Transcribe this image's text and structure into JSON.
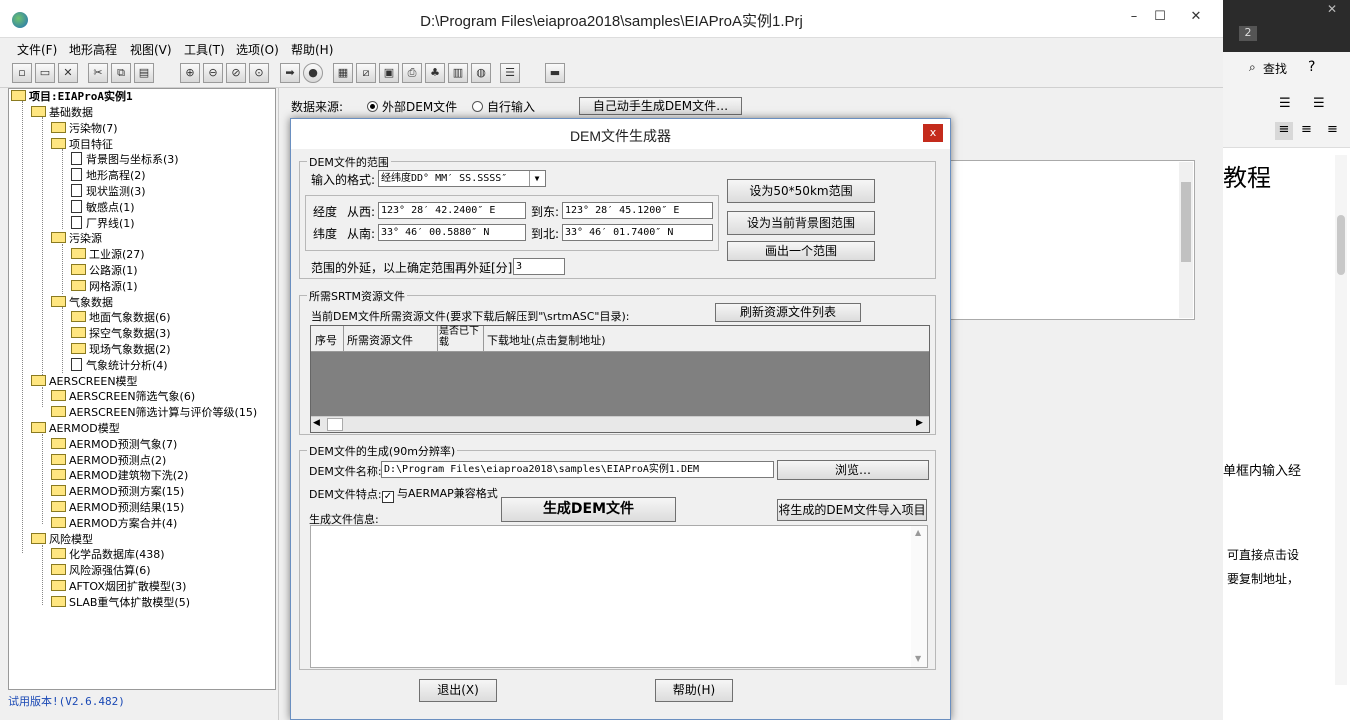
{
  "window": {
    "title": "D:\\Program Files\\eiaproa2018\\samples\\EIAProA实例1.Prj",
    "min": "–",
    "max": "☐",
    "close": "✕"
  },
  "menu": [
    "文件(F)",
    "地形高程",
    "视图(V)",
    "工具(T)",
    "选项(O)",
    "帮助(H)"
  ],
  "tree": {
    "root": "项目:EIAProA实例1",
    "nodes": [
      {
        "label": "基础数据",
        "level": 1,
        "type": "folder"
      },
      {
        "label": "污染物(7)",
        "level": 2,
        "type": "folder"
      },
      {
        "label": "项目特征",
        "level": 2,
        "type": "folder"
      },
      {
        "label": "背景图与坐标系(3)",
        "level": 3,
        "type": "doc"
      },
      {
        "label": "地形高程(2)",
        "level": 3,
        "type": "doc"
      },
      {
        "label": "现状监测(3)",
        "level": 3,
        "type": "doc"
      },
      {
        "label": "敏感点(1)",
        "level": 3,
        "type": "doc"
      },
      {
        "label": "厂界线(1)",
        "level": 3,
        "type": "doc"
      },
      {
        "label": "污染源",
        "level": 2,
        "type": "folder"
      },
      {
        "label": "工业源(27)",
        "level": 3,
        "type": "folder"
      },
      {
        "label": "公路源(1)",
        "level": 3,
        "type": "folder"
      },
      {
        "label": "网格源(1)",
        "level": 3,
        "type": "folder"
      },
      {
        "label": "气象数据",
        "level": 2,
        "type": "folder"
      },
      {
        "label": "地面气象数据(6)",
        "level": 3,
        "type": "folder"
      },
      {
        "label": "探空气象数据(3)",
        "level": 3,
        "type": "folder"
      },
      {
        "label": "现场气象数据(2)",
        "level": 3,
        "type": "folder"
      },
      {
        "label": "气象统计分析(4)",
        "level": 3,
        "type": "doc"
      },
      {
        "label": "AERSCREEN模型",
        "level": 1,
        "type": "folder"
      },
      {
        "label": "AERSCREEN筛选气象(6)",
        "level": 2,
        "type": "folder"
      },
      {
        "label": "AERSCREEN筛选计算与评价等级(15)",
        "level": 2,
        "type": "folder"
      },
      {
        "label": "AERMOD模型",
        "level": 1,
        "type": "folder"
      },
      {
        "label": "AERMOD预测气象(7)",
        "level": 2,
        "type": "folder"
      },
      {
        "label": "AERMOD预测点(2)",
        "level": 2,
        "type": "folder"
      },
      {
        "label": "AERMOD建筑物下洗(2)",
        "level": 2,
        "type": "folder"
      },
      {
        "label": "AERMOD预测方案(15)",
        "level": 2,
        "type": "folder"
      },
      {
        "label": "AERMOD预测结果(15)",
        "level": 2,
        "type": "folder"
      },
      {
        "label": "AERMOD方案合并(4)",
        "level": 2,
        "type": "folder"
      },
      {
        "label": "风险模型",
        "level": 1,
        "type": "folder"
      },
      {
        "label": "化学品数据库(438)",
        "level": 2,
        "type": "folder"
      },
      {
        "label": "风险源强估算(6)",
        "level": 2,
        "type": "folder"
      },
      {
        "label": "AFTOX烟团扩散模型(3)",
        "level": 2,
        "type": "folder"
      },
      {
        "label": "SLAB重气体扩散模型(5)",
        "level": 2,
        "type": "folder"
      }
    ]
  },
  "status": "试用版本!(V2.6.482)",
  "datasource": {
    "label": "数据来源:",
    "opt1": "外部DEM文件",
    "opt2": "自行输入",
    "gen_button": "自己动手生成DEM文件…"
  },
  "dialog": {
    "title": "DEM文件生成器",
    "close": "x",
    "range": {
      "legend": "DEM文件的范围",
      "format_label": "输入的格式:",
      "format_value": "经纬度DD° MM′ SS.SSSS″",
      "lon_label": "经度",
      "west_label": "从西:",
      "west_value": "123° 28′ 42.2400″ E",
      "east_label": "到东:",
      "east_value": "123° 28′ 45.1200″ E",
      "lat_label": "纬度",
      "south_label": "从南:",
      "south_value": "33° 46′ 00.5880″ N",
      "north_label": "到北:",
      "north_value": "33° 46′ 01.7400″ N",
      "btn_50km": "设为50*50km范围",
      "btn_bg": "设为当前背景图范围",
      "btn_draw": "画出一个范围",
      "extend_label": "范围的外延，以上确定范围再外延[分]",
      "extend_value": "3"
    },
    "srtm": {
      "legend": "所需SRTM资源文件",
      "desc": "当前DEM文件所需资源文件(要求下载后解压到\"\\srtmASC\"目录):",
      "refresh": "刷新资源文件列表",
      "columns": [
        "序号",
        "所需资源文件",
        "是否已下载",
        "下载地址(点击复制地址)"
      ]
    },
    "gen": {
      "legend": "DEM文件的生成(90m分辨率)",
      "name_label": "DEM文件名称:",
      "name_value": "D:\\Program Files\\eiaproa2018\\samples\\EIAProA实例1.DEM",
      "browse": "浏览…",
      "feature_label": "DEM文件特点:",
      "compat": "与AERMAP兼容格式",
      "generate": "生成DEM文件",
      "import": "将生成的DEM文件导入项目",
      "info_label": "生成文件信息:"
    },
    "exit": "退出(X)",
    "help": "帮助(H)"
  },
  "sidedoc": {
    "badge": "2",
    "search": "查找",
    "help": "?",
    "heading": "教程",
    "snippet1": "单框内输入经",
    "snippet2": "可直接点击设",
    "snippet3": "要复制地址，"
  }
}
